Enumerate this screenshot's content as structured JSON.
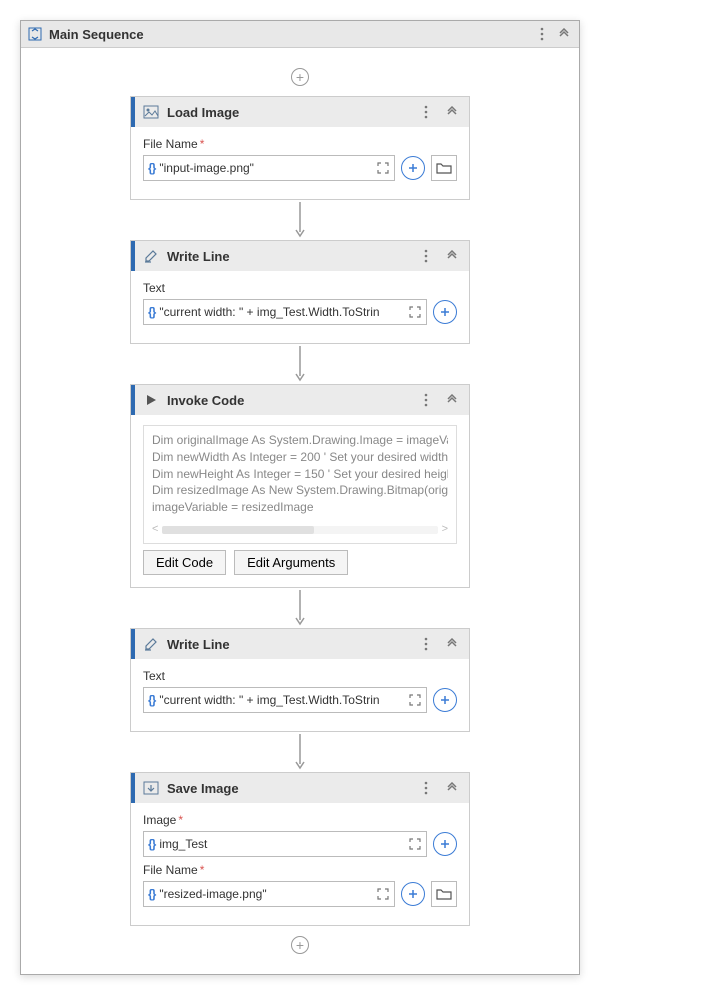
{
  "sequence": {
    "title": "Main Sequence"
  },
  "activities": {
    "loadImage": {
      "title": "Load Image",
      "fileNameLabel": "File Name",
      "fileNameValue": "\"input-image.png\""
    },
    "writeLine1": {
      "title": "Write Line",
      "textLabel": "Text",
      "textValue": "\"current width: \" + img_Test.Width.ToStrin"
    },
    "invokeCode": {
      "title": "Invoke Code",
      "codeLines": [
        "Dim originalImage As System.Drawing.Image = imageVa",
        "Dim newWidth As Integer = 200 ' Set your desired width",
        "Dim newHeight As Integer = 150 ' Set your desired heigh",
        "Dim resizedImage As New System.Drawing.Bitmap(origi",
        "imageVariable = resizedImage"
      ],
      "editCodeLabel": "Edit Code",
      "editArgumentsLabel": "Edit Arguments"
    },
    "writeLine2": {
      "title": "Write Line",
      "textLabel": "Text",
      "textValue": "\"current width: \" + img_Test.Width.ToStrin"
    },
    "saveImage": {
      "title": "Save Image",
      "imageLabel": "Image",
      "imageValue": "img_Test",
      "fileNameLabel": "File Name",
      "fileNameValue": "\"resized-image.png\""
    }
  }
}
